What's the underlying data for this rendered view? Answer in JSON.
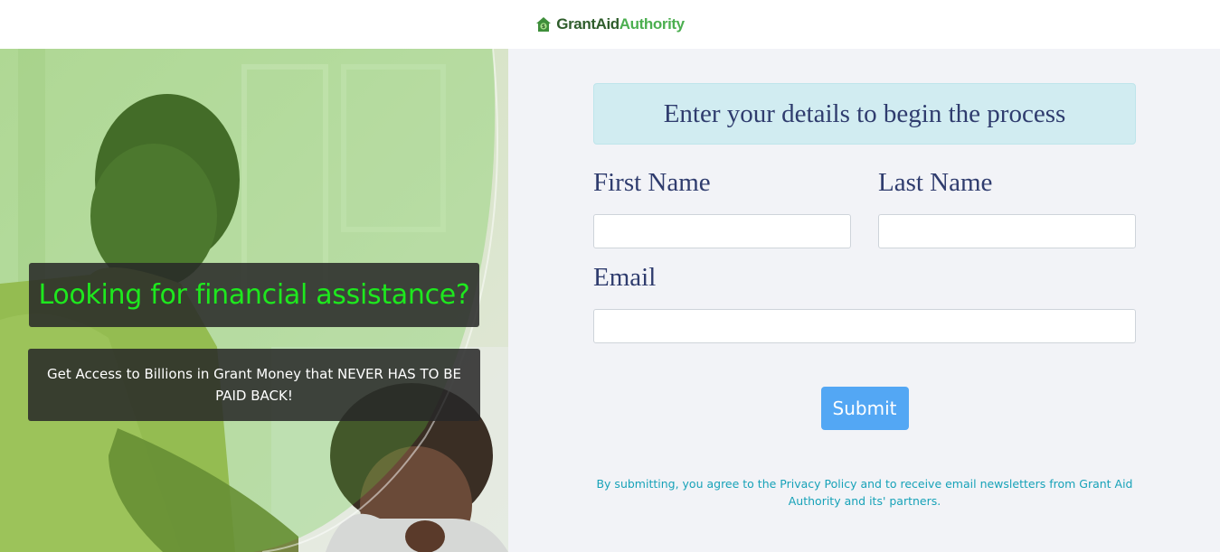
{
  "brand": {
    "name_dark": "GrantAid",
    "name_light": "Authority",
    "icon": "house-dollar-icon",
    "colors": {
      "dark": "#2f5d2c",
      "light": "#4caf50"
    }
  },
  "hero": {
    "headline": "Looking for financial assistance?",
    "subheadline": "Get Access to Billions in Grant Money that NEVER HAS TO BE PAID BACK!",
    "headline_color": "#1ee81e"
  },
  "form": {
    "banner": "Enter your details to begin the process",
    "first_name_label": "First Name",
    "first_name_value": "",
    "last_name_label": "Last Name",
    "last_name_value": "",
    "email_label": "Email",
    "email_value": "",
    "submit_label": "Submit",
    "disclaimer": "By submitting, you agree to the Privacy Policy and to receive email newsletters from Grant Aid Authority and its' partners."
  }
}
